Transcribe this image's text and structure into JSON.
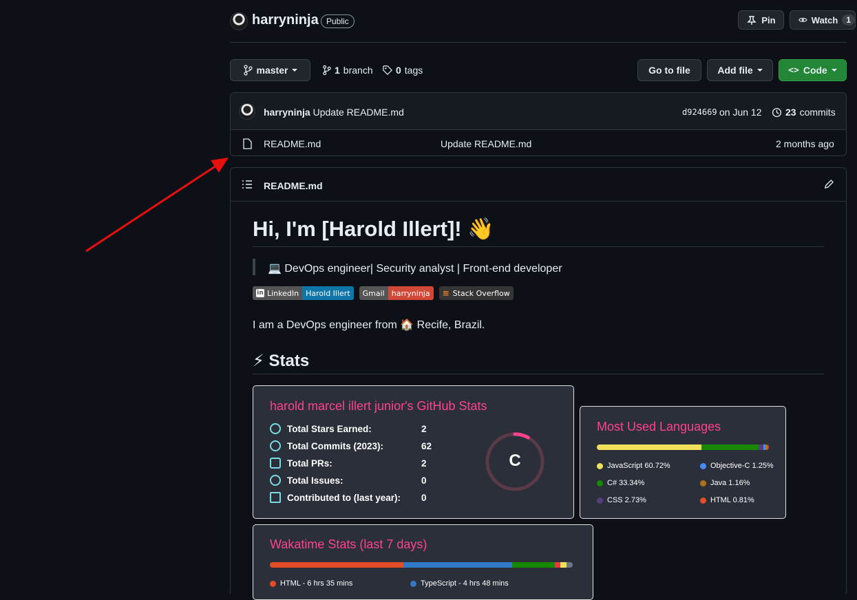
{
  "repo": {
    "owner": "harryninja",
    "visibility": "Public"
  },
  "header_actions": {
    "pin": "Pin",
    "watch": "Watch",
    "watch_count": "1"
  },
  "toolbar": {
    "branch": "master",
    "branch_count": "1",
    "branch_label": "branch",
    "tag_count": "0",
    "tag_label": "tags",
    "go_to_file": "Go to file",
    "add_file": "Add file",
    "code": "Code"
  },
  "commit": {
    "author": "harryninja",
    "message": "Update README.md",
    "sha": "d924669",
    "date": "on Jun 12",
    "count": "23",
    "count_label": "commits"
  },
  "files": [
    {
      "name": "README.md",
      "message": "Update README.md",
      "age": "2 months ago"
    }
  ],
  "readme": {
    "filename": "README.md",
    "heading": "Hi, I'm [Harold Illert]! 👋",
    "quote": "💻 DevOps engineer| Security analyst | Front-end developer",
    "badges": [
      {
        "label": "LinkedIn",
        "value": "Harold Illert",
        "label_color": "#555555",
        "value_color": "#0e76a8"
      },
      {
        "label": "Gmail",
        "value": "harryninja",
        "label_color": "#555555",
        "value_color": "#d14836"
      },
      {
        "label": "Stack Overflow",
        "value": "",
        "label_color": "#353535",
        "value_color": ""
      }
    ],
    "intro": "I am a DevOps engineer from 🏠 Recife, Brazil.",
    "stats_heading": "⚡ Stats"
  },
  "github_stats": {
    "title": "harold marcel illert junior's GitHub Stats",
    "rows": [
      {
        "label": "Total Stars Earned:",
        "value": "2"
      },
      {
        "label": "Total Commits (2023):",
        "value": "62"
      },
      {
        "label": "Total PRs:",
        "value": "2"
      },
      {
        "label": "Total Issues:",
        "value": "0"
      },
      {
        "label": "Contributed to (last year):",
        "value": "0"
      }
    ],
    "rank": "C",
    "rank_progress": 0.08
  },
  "languages": {
    "title": "Most Used Languages",
    "items": [
      {
        "name": "JavaScript 60.72%",
        "pct": 60.72,
        "color": "#f1e05a"
      },
      {
        "name": "Objective-C 1.25%",
        "pct": 1.25,
        "color": "#438eff"
      },
      {
        "name": "C# 33.34%",
        "pct": 33.34,
        "color": "#178600"
      },
      {
        "name": "Java 1.16%",
        "pct": 1.16,
        "color": "#b07219"
      },
      {
        "name": "CSS 2.73%",
        "pct": 2.73,
        "color": "#563d7c"
      },
      {
        "name": "HTML 0.81%",
        "pct": 0.81,
        "color": "#e34c26"
      }
    ]
  },
  "wakatime": {
    "title": "Wakatime Stats (last 7 days)",
    "items": [
      {
        "name": "HTML - 6 hrs 35 mins",
        "color": "#e34c26"
      },
      {
        "name": "TypeScript - 4 hrs 48 mins",
        "color": "#3178c6"
      }
    ]
  }
}
